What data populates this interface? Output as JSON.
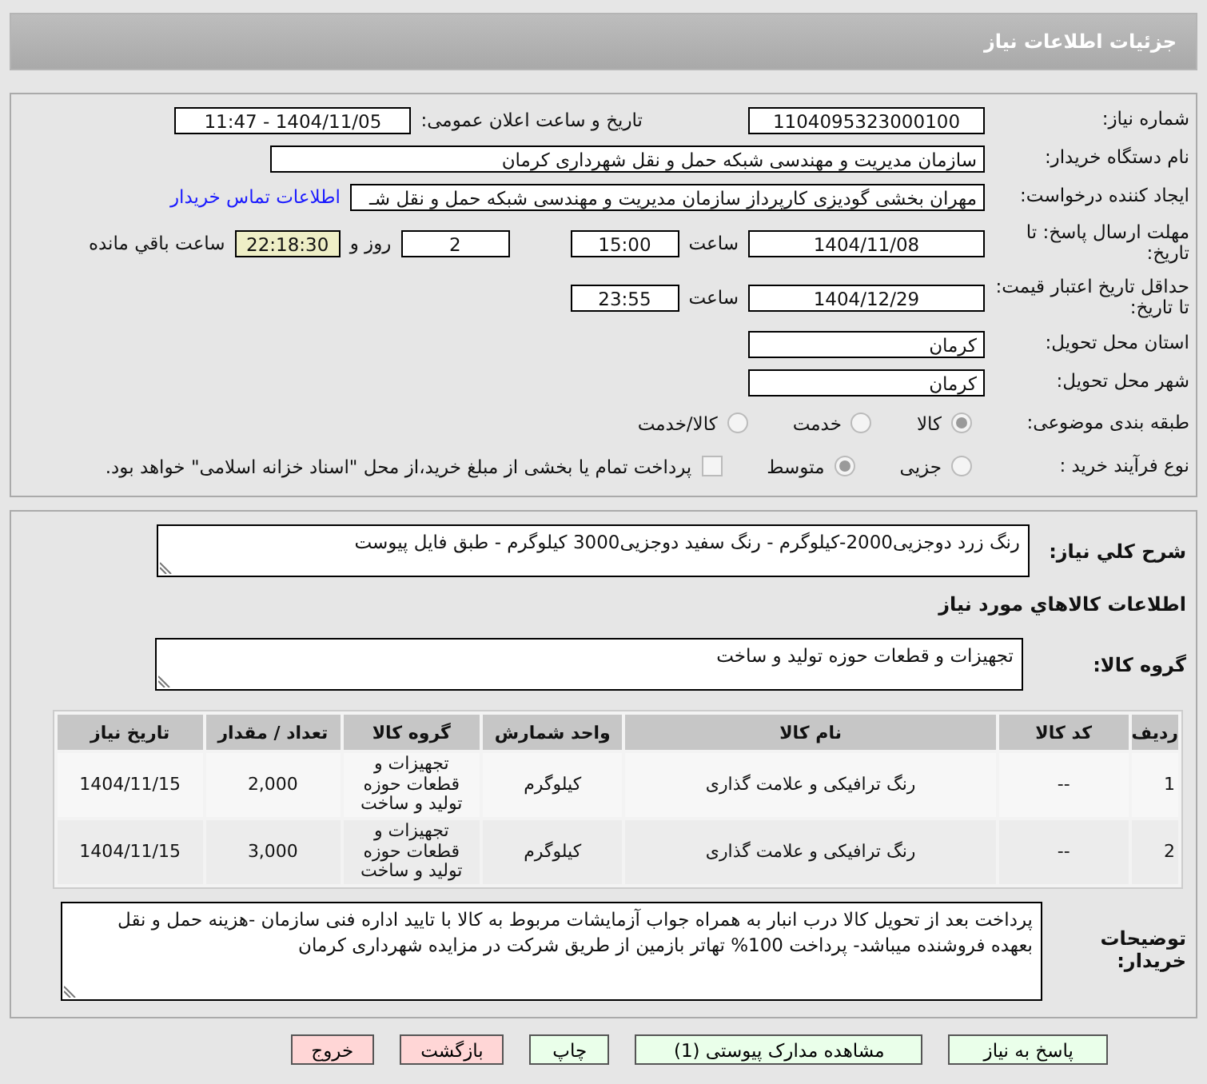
{
  "header": {
    "title": "جزئیات اطلاعات نیاز"
  },
  "need_number": {
    "label": "شماره نیاز:",
    "value": "1104095323000100"
  },
  "announce": {
    "label": "تاریخ و ساعت اعلان عمومی:",
    "value": "1404/11/05 - 11:47"
  },
  "buyer": {
    "label": "نام دستگاه خریدار:",
    "value": "سازمان مدیریت و مهندسی شبکه حمل و نقل شهرداری کرمان"
  },
  "requester": {
    "label": "ایجاد کننده درخواست:",
    "value": "مهران بخشی گودیزی کارپرداز سازمان مدیریت و مهندسی شبکه حمل و نقل شـ",
    "link": "اطلاعات تماس خریدار"
  },
  "deadline": {
    "label": "مهلت ارسال پاسخ: تا تاریخ:",
    "date": "1404/11/08",
    "time_label": "ساعت",
    "time": "15:00",
    "days": "2",
    "days_label": "روز و",
    "remaining": "22:18:30",
    "remaining_label": "ساعت باقي مانده"
  },
  "validity": {
    "label": "حداقل تاریخ اعتبار قیمت: تا تاریخ:",
    "date": "1404/12/29",
    "time_label": "ساعت",
    "time": "23:55"
  },
  "province": {
    "label": "استان محل تحویل:",
    "value": "کرمان"
  },
  "city": {
    "label": "شهر محل تحویل:",
    "value": "کرمان"
  },
  "classification": {
    "label": "طبقه بندی موضوعی:",
    "options": [
      {
        "label": "کالا",
        "selected": true
      },
      {
        "label": "خدمت",
        "selected": false
      },
      {
        "label": "کالا/خدمت",
        "selected": false
      }
    ]
  },
  "purchase_type": {
    "label": "نوع فرآیند خرید :",
    "options": [
      {
        "label": "جزیی",
        "selected": false
      },
      {
        "label": "متوسط",
        "selected": true
      }
    ],
    "treasury": {
      "label": "پرداخت تمام یا بخشی از مبلغ خرید،از محل \"اسناد خزانه اسلامی\" خواهد بود.",
      "checked": false
    }
  },
  "description": {
    "label": "شرح کلي نياز:",
    "value": "رنگ زرد دوجزیی2000-کیلوگرم - رنگ سفید دوجزیی3000 کیلوگرم - طبق فایل پیوست"
  },
  "items_title": "اطلاعات کالاهاي مورد نياز",
  "goods_group": {
    "label": "گروه کالا:",
    "value": "تجهیزات و قطعات حوزه تولید و ساخت"
  },
  "table": {
    "columns": [
      "ردیف",
      "کد کالا",
      "نام کالا",
      "واحد شمارش",
      "گروه کالا",
      "تعداد / مقدار",
      "تاریخ نیاز"
    ],
    "rows": [
      [
        "1",
        "--",
        "رنگ ترافیکی و علامت گذاری",
        "کیلوگرم",
        "تجهیزات و قطعات حوزه تولید و ساخت",
        "2,000",
        "1404/11/15"
      ],
      [
        "2",
        "--",
        "رنگ ترافیکی و علامت گذاری",
        "کیلوگرم",
        "تجهیزات و قطعات حوزه تولید و ساخت",
        "3,000",
        "1404/11/15"
      ]
    ]
  },
  "notes": {
    "label": "توضیحات خریدار:",
    "value": "پرداخت بعد از تحویل کالا درب انبار به همراه جواب آزمایشات مربوط به کالا با تایید اداره فنی سازمان -هزینه حمل و نقل بعهده فروشنده میباشد- پرداخت 100% تهاتر بازمین از طریق شرکت در مزایده شهرداری کرمان"
  },
  "buttons": [
    {
      "label": "پاسخ به نیاز",
      "kind": "primary"
    },
    {
      "label": "مشاهده مدارک پیوستی (1)",
      "kind": "primary"
    },
    {
      "label": "چاپ",
      "kind": "primary"
    },
    {
      "label": "بازگشت",
      "kind": "danger"
    },
    {
      "label": "خروج",
      "kind": "danger"
    }
  ]
}
